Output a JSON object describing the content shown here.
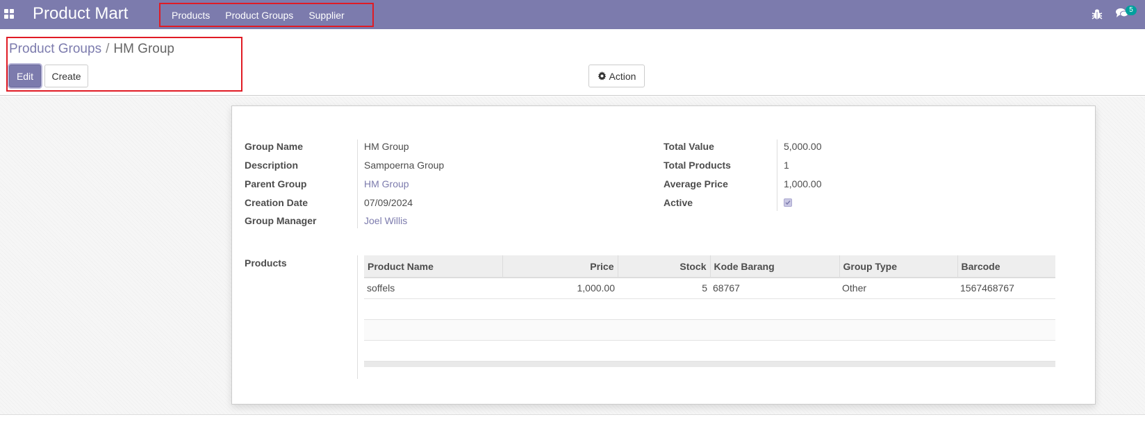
{
  "navbar": {
    "brand": "Product Mart",
    "menu": [
      {
        "label": "Products"
      },
      {
        "label": "Product Groups"
      },
      {
        "label": "Supplier"
      }
    ],
    "chat_count": "5",
    "icons": [
      "apps-icon",
      "bug-icon",
      "chat-icon"
    ]
  },
  "breadcrumb": {
    "parent": "Product Groups",
    "separator": "/",
    "current": "HM Group"
  },
  "buttons": {
    "edit": "Edit",
    "create": "Create",
    "action": "Action"
  },
  "form": {
    "left": [
      {
        "label": "Group Name",
        "value": "HM Group"
      },
      {
        "label": "Description",
        "value": "Sampoerna Group"
      },
      {
        "label": "Parent Group",
        "value": "HM Group"
      },
      {
        "label": "Creation Date",
        "value": "07/09/2024"
      },
      {
        "label": "Group Manager",
        "value": "Joel Willis"
      }
    ],
    "right": [
      {
        "label": "Total Value",
        "value": "5,000.00"
      },
      {
        "label": "Total Products",
        "value": "1"
      },
      {
        "label": "Average Price",
        "value": "1,000.00"
      },
      {
        "label": "Active",
        "value": true
      }
    ],
    "products_label": "Products"
  },
  "products_table": {
    "columns": [
      "Product Name",
      "Price",
      "Stock",
      "Kode Barang",
      "Group Type",
      "Barcode"
    ],
    "rows": [
      {
        "name": "soffels",
        "price": "1,000.00",
        "stock": "5",
        "kode": "68767",
        "type": "Other",
        "barcode": "1567468767"
      }
    ]
  },
  "colors": {
    "primary": "#7c7bad",
    "highlight": "#e01b24",
    "badge": "#00a09d"
  }
}
